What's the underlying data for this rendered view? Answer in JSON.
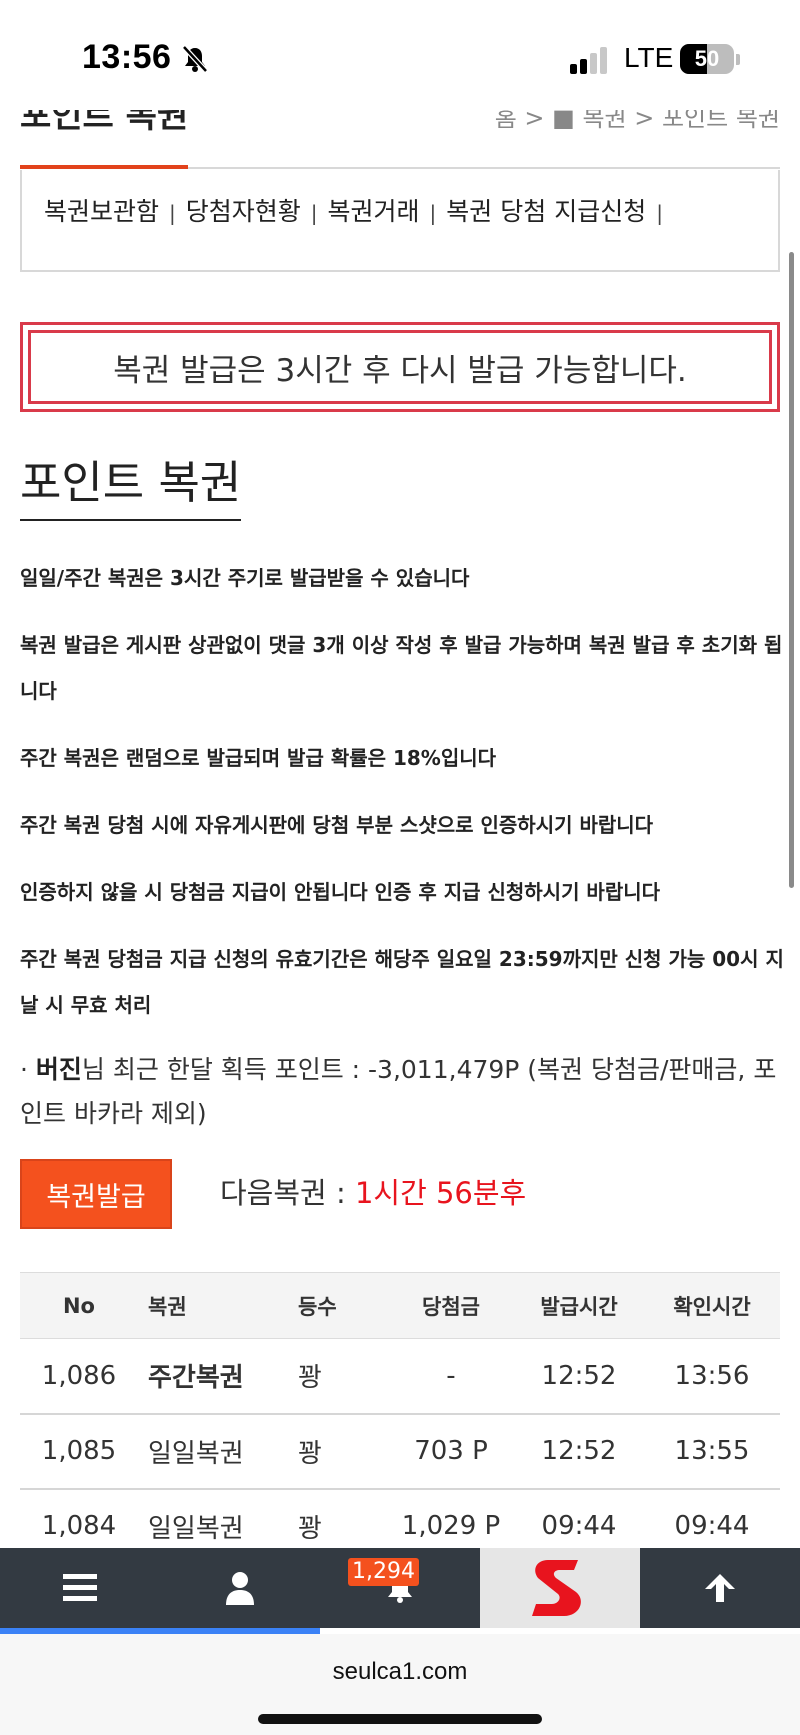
{
  "status_bar": {
    "time": "13:56",
    "network": "LTE",
    "battery": "50",
    "battery_level": 0.5
  },
  "header": {
    "title": "포인트 복권",
    "breadcrumb": [
      "홈",
      "복권",
      "포인트 복권"
    ],
    "breadcrumb_text": "홈 > ■ 복권 > 포인트 복권"
  },
  "subnav": {
    "items": [
      "복권보관함",
      "당첨자현황",
      "복권거래",
      "복권 당첨 지급신청"
    ]
  },
  "notice": "복권 발급은 3시간 후 다시 발급 가능합니다.",
  "page_title": "포인트 복권",
  "rules": [
    "일일/주간 복권은 3시간 주기로 발급받을 수 있습니다",
    "복권 발급은 게시판 상관없이 댓글 3개 이상 작성 후 발급 가능하며 복권 발급 후 초기화 됩니다",
    "주간 복권은 랜덤으로 발급되며 발급 확률은 18%입니다",
    "주간 복권 당첨 시에 자유게시판에 당첨 부분 스샷으로 인증하시기 바랍니다",
    "인증하지 않을 시 당첨금 지급이 안됩니다 인증 후 지급 신청하시기 바랍니다",
    "주간 복권 당첨금 지급 신청의 유효기간은 해당주 일요일 23:59까지만 신청 가능 00시 지날 시 무효 처리"
  ],
  "points": {
    "bullet": "·",
    "user": "버진",
    "text": "님 최근 한달 획득 포인트 : -3,011,479P (복권 당첨금/판매금, 포인트 바카라 제외)"
  },
  "issue_button": "복권발급",
  "next": {
    "label": "다음복권 : ",
    "value": "1시간 56분후"
  },
  "table": {
    "headers": [
      "No",
      "복권",
      "등수",
      "당첨금",
      "발급시간",
      "확인시간"
    ],
    "rows": [
      [
        "1,086",
        "주간복권",
        "꽝",
        "-",
        "12:52",
        "13:56"
      ],
      [
        "1,085",
        "일일복권",
        "꽝",
        "703 P",
        "12:52",
        "13:55"
      ],
      [
        "1,084",
        "일일복권",
        "꽝",
        "1,029 P",
        "09:44",
        "09:44"
      ]
    ]
  },
  "bottom_bar": {
    "notification_count": "1,294",
    "icons": [
      "menu-icon",
      "user-icon",
      "bell-icon",
      "site-logo",
      "arrow-up-icon"
    ]
  },
  "browser": {
    "url": "seulca1.com"
  },
  "colors": {
    "accent": "#f4511e",
    "notice_border": "#d93a4a",
    "countdown": "#e8141e",
    "bottom_bar": "#333a42"
  }
}
